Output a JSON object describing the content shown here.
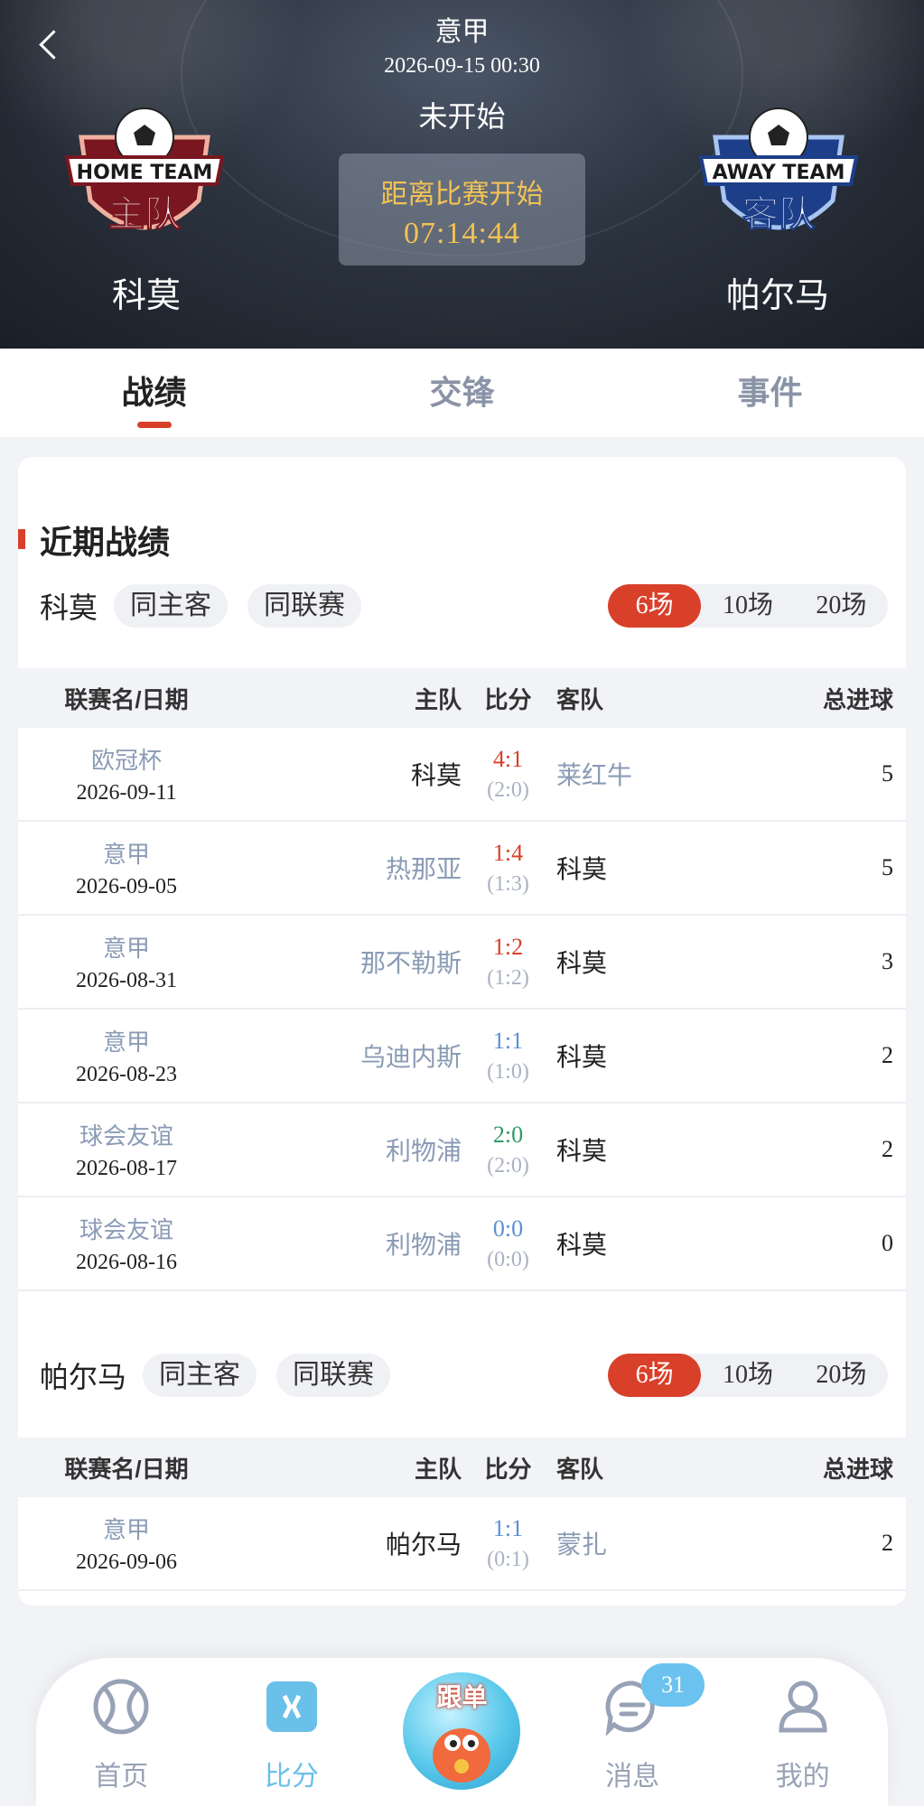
{
  "header": {
    "league": "意甲",
    "match_time": "2026-09-15 00:30",
    "status": "未开始",
    "countdown_label": "距离比赛开始",
    "countdown_time": "07:14:44",
    "home_team": "科莫",
    "away_team": "帕尔马",
    "home_badge": {
      "line1": "HOME TEAM",
      "line2": "主队"
    },
    "away_badge": {
      "line1": "AWAY TEAM",
      "line2": "客队"
    }
  },
  "tabs": [
    {
      "label": "战绩",
      "active": true
    },
    {
      "label": "交锋",
      "active": false
    },
    {
      "label": "事件",
      "active": false
    }
  ],
  "section": {
    "title": "近期战绩"
  },
  "table_headers": {
    "date": "联赛名/日期",
    "home": "主队",
    "score": "比分",
    "away": "客队",
    "total": "总进球"
  },
  "blocks": [
    {
      "team": "科莫",
      "chips": [
        "同主客",
        "同联赛"
      ],
      "counts": [
        "6场",
        "10场",
        "20场"
      ],
      "active_count": "6场",
      "rows": [
        {
          "league": "欧冠杯",
          "date": "2026-09-11",
          "home": "科莫",
          "score": "4:1",
          "ht": "(2:0)",
          "away": "莱红牛",
          "total": "5",
          "result": "red"
        },
        {
          "league": "意甲",
          "date": "2026-09-05",
          "home": "热那亚",
          "score": "1:4",
          "ht": "(1:3)",
          "away": "科莫",
          "total": "5",
          "result": "red"
        },
        {
          "league": "意甲",
          "date": "2026-08-31",
          "home": "那不勒斯",
          "score": "1:2",
          "ht": "(1:2)",
          "away": "科莫",
          "total": "3",
          "result": "red"
        },
        {
          "league": "意甲",
          "date": "2026-08-23",
          "home": "乌迪内斯",
          "score": "1:1",
          "ht": "(1:0)",
          "away": "科莫",
          "total": "2",
          "result": "blue"
        },
        {
          "league": "球会友谊",
          "date": "2026-08-17",
          "home": "利物浦",
          "score": "2:0",
          "ht": "(2:0)",
          "away": "科莫",
          "total": "2",
          "result": "green"
        },
        {
          "league": "球会友谊",
          "date": "2026-08-16",
          "home": "利物浦",
          "score": "0:0",
          "ht": "(0:0)",
          "away": "科莫",
          "total": "0",
          "result": "blue"
        }
      ]
    },
    {
      "team": "帕尔马",
      "chips": [
        "同主客",
        "同联赛"
      ],
      "counts": [
        "6场",
        "10场",
        "20场"
      ],
      "active_count": "6场",
      "rows": [
        {
          "league": "意甲",
          "date": "2026-09-06",
          "home": "帕尔马",
          "score": "1:1",
          "ht": "(0:1)",
          "away": "蒙扎",
          "total": "2",
          "result": "blue"
        }
      ]
    }
  ],
  "bottom_nav": {
    "items": [
      {
        "label": "首页",
        "icon": "basketball-icon"
      },
      {
        "label": "比分",
        "icon": "scoreboard-icon"
      },
      {
        "label": "跟单",
        "icon": "mascot-icon"
      },
      {
        "label": "消息",
        "icon": "message-icon",
        "badge": "31"
      },
      {
        "label": "我的",
        "icon": "profile-icon"
      }
    ]
  },
  "colors": {
    "accent": "#d8402a",
    "win": "#d8402a",
    "draw": "#5b8fd6",
    "loss": "#2f9a6a",
    "nav_active": "#69c0e9"
  }
}
